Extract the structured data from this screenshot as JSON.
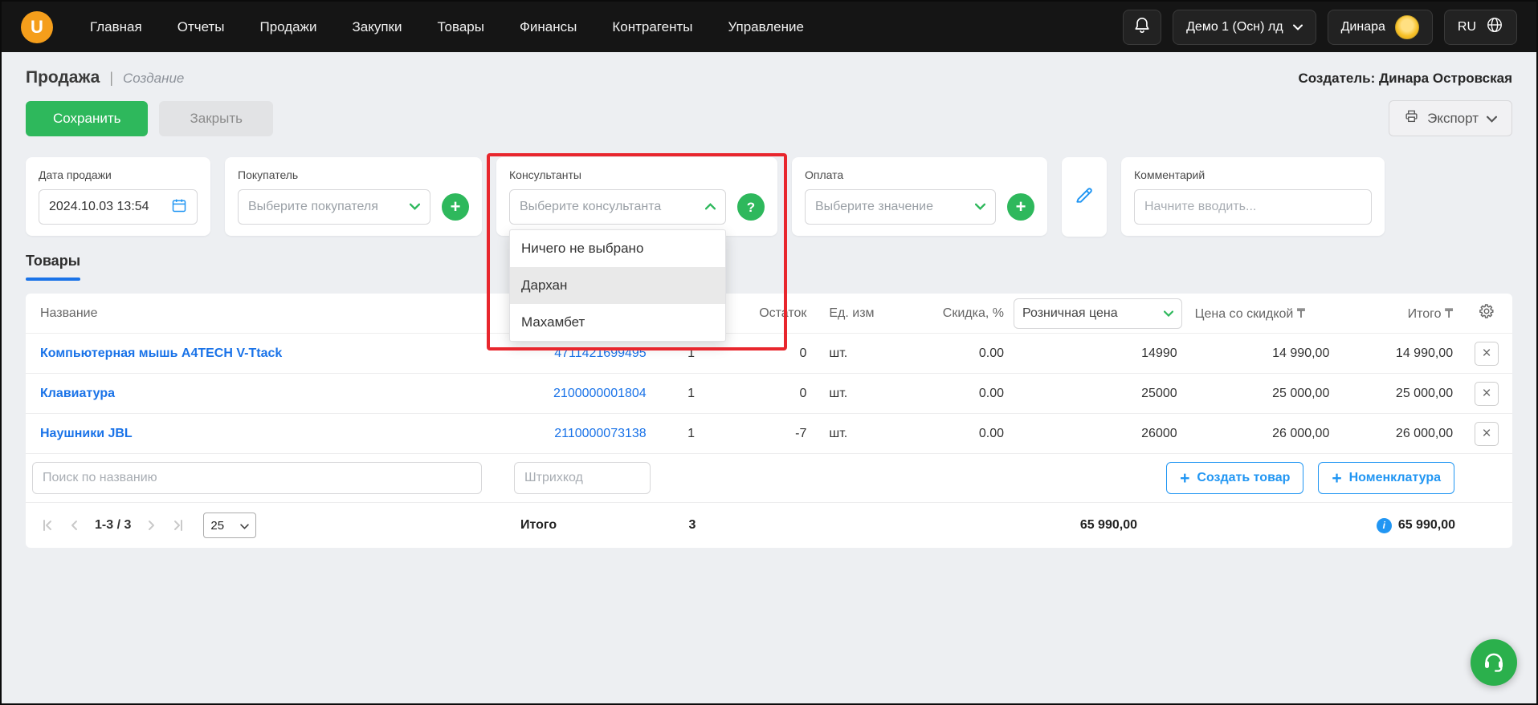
{
  "colors": {
    "accent_green": "#2eb85c",
    "link_blue": "#1a73e8",
    "highlight_red": "#e8262d",
    "topbar_bg": "#151515",
    "logo_orange": "#f59e1b"
  },
  "icons": {
    "logo_letter": "U",
    "plus": "+",
    "question": "?",
    "close": "×",
    "info": "i"
  },
  "topnav": {
    "items": [
      "Главная",
      "Отчеты",
      "Продажи",
      "Закупки",
      "Товары",
      "Финансы",
      "Контрагенты",
      "Управление"
    ],
    "company_selector": "Демо 1 (Осн) лд",
    "user_name": "Динара",
    "language": "RU"
  },
  "page": {
    "title": "Продажа",
    "separator": "|",
    "subtitle": "Создание",
    "creator": "Создатель: Динара Островская"
  },
  "toolbar": {
    "save": "Сохранить",
    "close": "Закрыть",
    "export": "Экспорт"
  },
  "form": {
    "sale_date": {
      "label": "Дата продажи",
      "value": "2024.10.03 13:54"
    },
    "buyer": {
      "label": "Покупатель",
      "placeholder": "Выберите покупателя"
    },
    "consultants": {
      "label": "Консультанты",
      "placeholder": "Выберите консультанта",
      "options": [
        "Ничего не выбрано",
        "Дархан",
        "Махамбет"
      ]
    },
    "payment": {
      "label": "Оплата",
      "placeholder": "Выберите значение"
    },
    "comment": {
      "label": "Комментарий",
      "placeholder": "Начните вводить..."
    }
  },
  "tabs": {
    "products": "Товары"
  },
  "table": {
    "headers": {
      "name": "Название",
      "stock": "Остаток",
      "unit": "Ед. изм",
      "discount": "Скидка, %",
      "retail_price": "Розничная цена",
      "discounted_price": "Цена со скидкой ₸",
      "total": "Итого ₸"
    },
    "rows": [
      {
        "name": "Компьютерная мышь A4TECH V-Ttack",
        "barcode": "4711421699495",
        "qty": "1",
        "stock": "0",
        "unit": "шт.",
        "discount": "0.00",
        "retail_price": "14990",
        "discounted_price": "14 990,00",
        "total": "14 990,00"
      },
      {
        "name": "Клавиатура",
        "barcode": "2100000001804",
        "qty": "1",
        "stock": "0",
        "unit": "шт.",
        "discount": "0.00",
        "retail_price": "25000",
        "discounted_price": "25 000,00",
        "total": "25 000,00"
      },
      {
        "name": "Наушники JBL",
        "barcode": "2110000073138",
        "qty": "1",
        "stock": "-7",
        "unit": "шт.",
        "discount": "0.00",
        "retail_price": "26000",
        "discounted_price": "26 000,00",
        "total": "26 000,00"
      }
    ],
    "search_placeholder": "Поиск по названию",
    "barcode_placeholder": "Штрихкод",
    "create_product": "Создать товар",
    "nomenclature": "Номенклатура"
  },
  "footer": {
    "range": "1-3 / 3",
    "page_size": "25",
    "total_label": "Итого",
    "total_qty": "3",
    "subtotal": "65 990,00",
    "grand_total": "65 990,00"
  }
}
